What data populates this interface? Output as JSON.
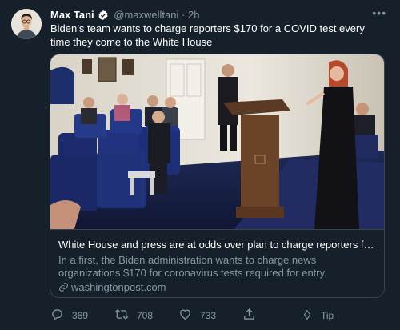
{
  "tweet": {
    "author_name": "Max Tani",
    "handle": "@maxwelltani",
    "separator": "·",
    "time": "2h",
    "more_label": "•••",
    "text": "Biden’s team wants to charge reporters $170 for a COVID test every time they come to the White House"
  },
  "card": {
    "title": "White House and press are at odds over plan to charge reporters for c...",
    "description": "In a first, the Biden administration wants to charge news organizations $170 for coronavirus tests required for entry.",
    "domain": "washingtonpost.com"
  },
  "actions": {
    "replies": "369",
    "retweets": "708",
    "likes": "733",
    "tip": "Tip"
  },
  "icons": [
    "verified-icon",
    "more-icon",
    "link-icon",
    "reply-icon",
    "retweet-icon",
    "like-icon",
    "share-icon",
    "tip-icon"
  ],
  "colors": {
    "background": "#15202b",
    "secondary_text": "#8899a6",
    "border": "#38444d",
    "accent": "#1da1f2"
  }
}
